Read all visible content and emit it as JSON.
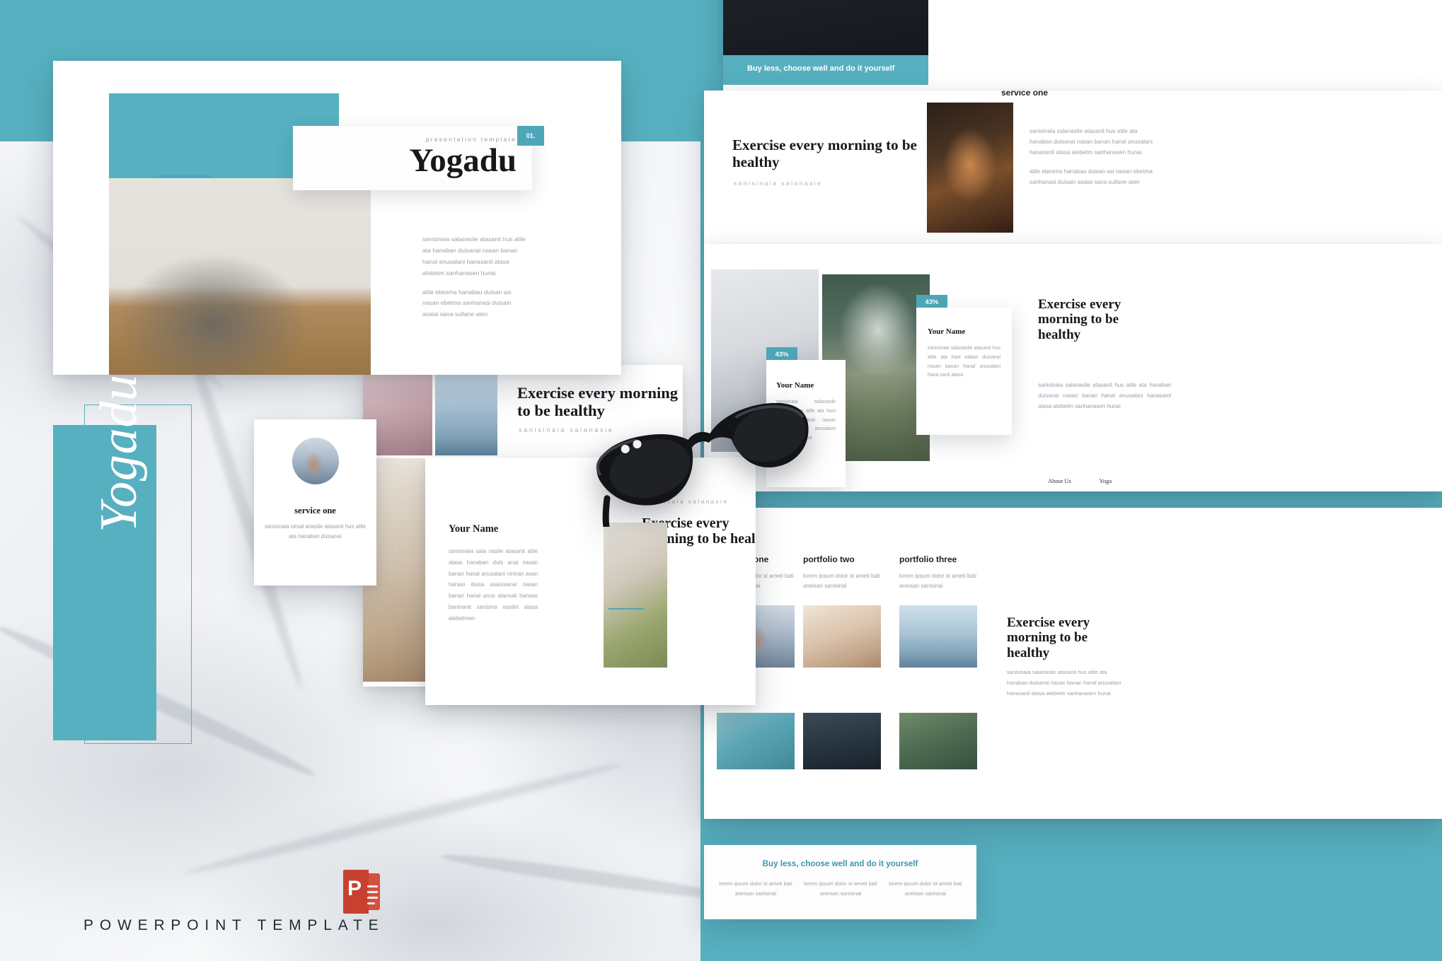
{
  "brand": {
    "script_name": "Yogadu",
    "subtitle": "POWERPOINT TEMPLATE",
    "accent_color": "#56b0c0",
    "accent_dark": "#4ea7b8",
    "ppt_letter": "P"
  },
  "title_slide": {
    "eyebrow": "presentation template",
    "title": "Yogadu",
    "badge": "01.",
    "body_paragraph_1": "sanisinaia salanasile atasanit hus atile ata hanaban duisanai nasan banan hanal anusalani hanasanil atasa atebetm sanhanasen hunai",
    "body_paragraph_2": "atile ebesma hanabau duisan asi nasan ebetma sanhanasi duisain asaiai sana sullane aten"
  },
  "exercise_slide_mid": {
    "title": "Exercise every morning to be healthy",
    "subtitle": "sanisinaia salanasie"
  },
  "service_card": {
    "title": "service one",
    "body": "sanisinaia oesal anasile atasanit hus atile ata hanaban duisanai"
  },
  "name_slide_mid": {
    "name": "Your Name",
    "body": "sanisinaia sala nasile atasanit atile atasa hanaban duis anai nasan banan hanal anusalani ninhan asan hanasi duisa asauisanai nasan banan hanal anus alansali hanase baninanit sanisina nasilet atasa atebetmen",
    "subtitle": "sanisinaia salanasie",
    "title": "Exercise every morning to be healthy"
  },
  "top_right_slide": {
    "banner": "Buy less, choose well and do it yourself"
  },
  "exercise_slide_right": {
    "service_label": "service one",
    "title": "Exercise every morning to be healthy",
    "subtitle": "sanisinaia salanasie",
    "body_paragraph_1": "sanisinaia salanasile atasanit hus atile ata hanaban duisanai nasan banan hanal anusalani hanasanil atasa atebetm sanhanasen hunai",
    "body_paragraph_2": "atile ebesma hanabau duisan asi nasan ebetma sanhanasi duisain asaiai sana sullane aten"
  },
  "team_slide": {
    "badge_a": "43%",
    "badge_b": "43%",
    "card_a": {
      "name": "Your Name",
      "body": "sanisinaia salanasile atasanit hus atile ata hani eaban duisanai nasan banan hanal anusalani hana sanil atasa"
    },
    "card_b": {
      "name": "Your Name",
      "body": "sanisinaia salanasile atasanit hus atile ata hani eaban duisanai nasan banan hanal anusalani hana sanil atasa"
    },
    "title": "Exercise every morning to be healthy",
    "body": "sanisinaia salanasile atasanit hus atile ata hanaban duisanai nasan banan hanal anusalani hanasanil atasa atebetm sanhanasen hunai",
    "nav_about": "About Us",
    "nav_yoga": "Yoga"
  },
  "portfolio_slide": {
    "columns": [
      {
        "title": "portfolio one",
        "body": "lorem ipsum dolor st ameti bati aneisan sanisinai"
      },
      {
        "title": "portfolio two",
        "body": "lorem ipsum dolor st ameti bati aneisan sanisinai"
      },
      {
        "title": "portfolio three",
        "body": "lorem ipsum dolor st ameti bati aneisan sanisinai"
      }
    ],
    "exercise_title": "Exercise every morning to be healthy",
    "exercise_body": "sanisinaia salanasile atasanit hus atile ata hanaban duisanai nasan banan hanal anusalani hanasanil atasa atebetm sanhanasen hunai"
  },
  "buy_card": {
    "title": "Buy less, choose well and do it yourself",
    "columns": [
      "lorem ipsum dolor st ameti bati aneisan sanisinai",
      "lorem ipsum dolor st ameti bati aneisan sanisinai",
      "lorem ipsum dolor st ameti bati aneisan sanisinai"
    ]
  }
}
